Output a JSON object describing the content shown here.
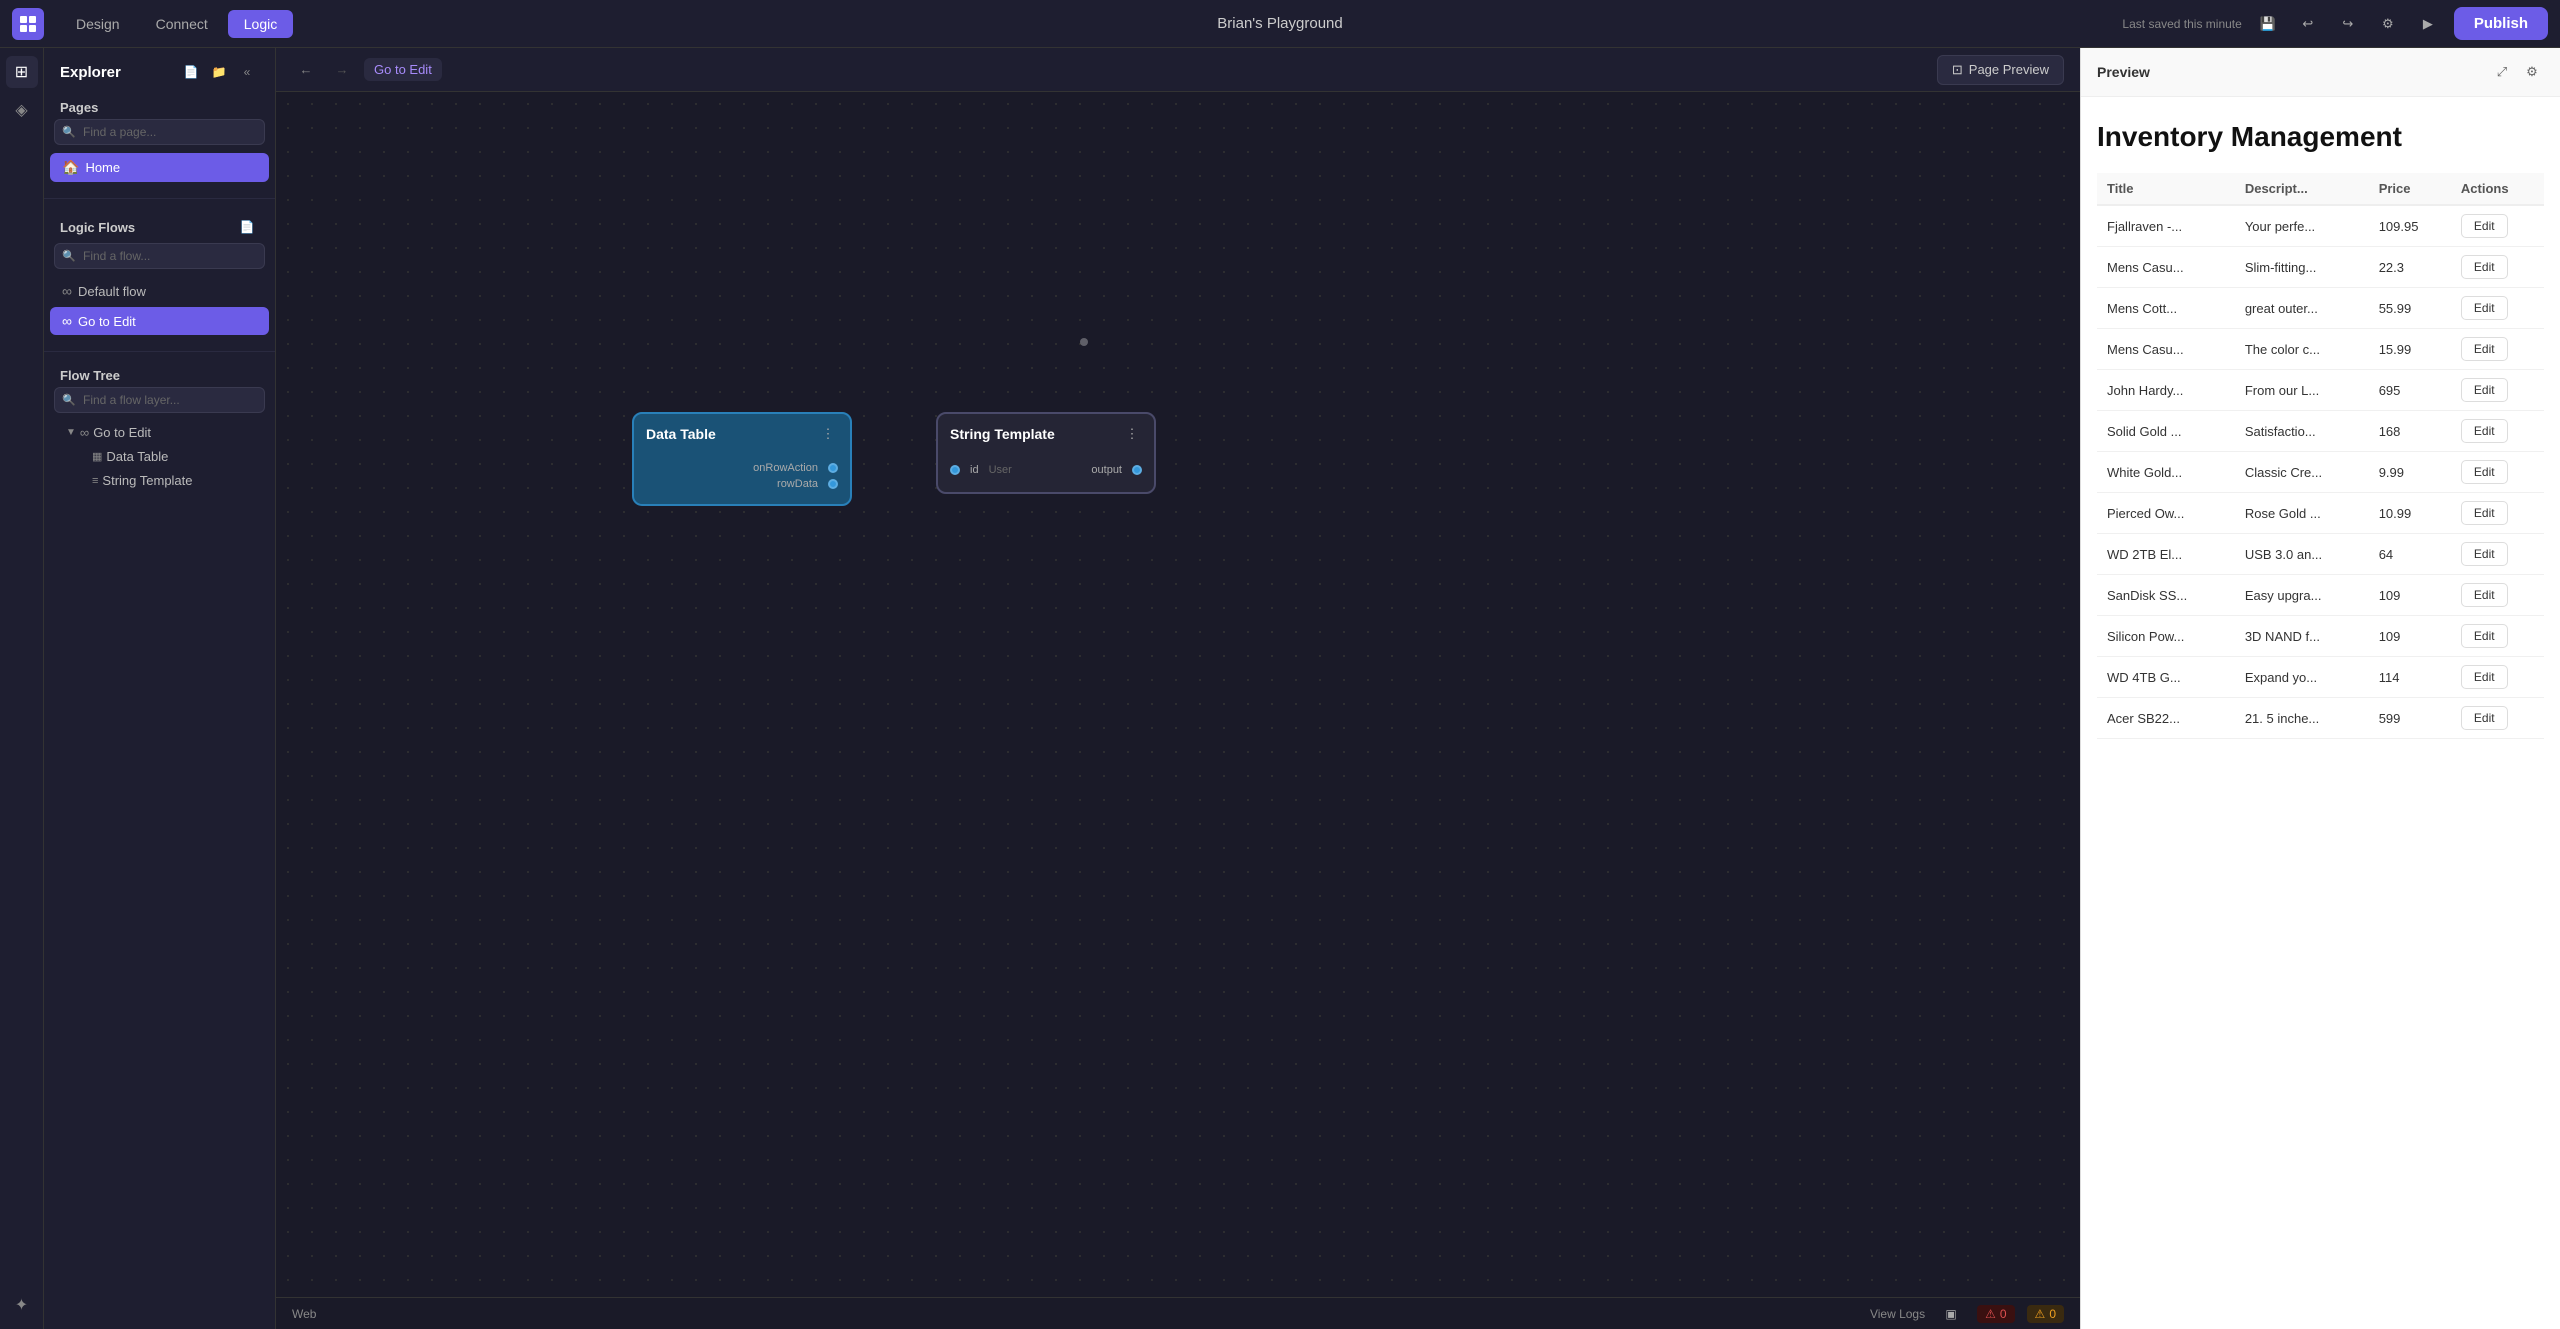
{
  "topbar": {
    "title": "Brian's Playground",
    "tabs": [
      "Design",
      "Connect",
      "Logic"
    ],
    "active_tab": "Logic",
    "save_info": "Last saved  this minute",
    "publish_label": "Publish"
  },
  "sidebar": {
    "title": "Explorer",
    "pages_section": "Pages",
    "pages_search_placeholder": "Find a page...",
    "pages": [
      {
        "label": "Home",
        "icon": "🏠",
        "active": true
      }
    ],
    "logic_flows_section": "Logic Flows",
    "flows_search_placeholder": "Find a flow...",
    "flows": [
      {
        "label": "Default flow",
        "active": false
      },
      {
        "label": "Go to Edit",
        "active": true
      }
    ],
    "flow_tree_section": "Flow Tree",
    "flow_tree_search_placeholder": "Find a flow layer...",
    "flow_tree": {
      "root": "Go to Edit",
      "children": [
        {
          "label": "Data Table",
          "icon": "table"
        },
        {
          "label": "String Template",
          "icon": "string"
        }
      ]
    }
  },
  "canvas": {
    "breadcrumb": "Go to Edit",
    "page_preview_label": "Page Preview",
    "nodes": [
      {
        "id": "data-table",
        "title": "Data Table",
        "type": "data-table",
        "ports_out": [
          "onRowAction",
          "rowData"
        ]
      },
      {
        "id": "string-template",
        "title": "String Template",
        "type": "string-template",
        "ports_in": [
          "id",
          "User"
        ],
        "ports_out": [
          "output"
        ]
      }
    ]
  },
  "preview": {
    "title": "Preview",
    "main_title": "Inventory Management",
    "columns": [
      "Title",
      "Descript...",
      "Price",
      "Actions"
    ],
    "rows": [
      {
        "title": "Fjallraven -...",
        "desc": "Your perfe...",
        "price": "109.95"
      },
      {
        "title": "Mens Casu...",
        "desc": "Slim-fitting...",
        "price": "22.3"
      },
      {
        "title": "Mens Cott...",
        "desc": "great outer...",
        "price": "55.99"
      },
      {
        "title": "Mens Casu...",
        "desc": "The color c...",
        "price": "15.99"
      },
      {
        "title": "John Hardy...",
        "desc": "From our L...",
        "price": "695"
      },
      {
        "title": "Solid Gold ...",
        "desc": "Satisfactio...",
        "price": "168"
      },
      {
        "title": "White Gold...",
        "desc": "Classic Cre...",
        "price": "9.99"
      },
      {
        "title": "Pierced Ow...",
        "desc": "Rose Gold ...",
        "price": "10.99"
      },
      {
        "title": "WD 2TB El...",
        "desc": "USB 3.0 an...",
        "price": "64"
      },
      {
        "title": "SanDisk SS...",
        "desc": "Easy upgra...",
        "price": "109"
      },
      {
        "title": "Silicon Pow...",
        "desc": "3D NAND f...",
        "price": "109"
      },
      {
        "title": "WD 4TB G...",
        "desc": "Expand yo...",
        "price": "114"
      },
      {
        "title": "Acer SB22...",
        "desc": "21. 5 inche...",
        "price": "599"
      }
    ],
    "row_action_label": "Edit"
  },
  "statusbar": {
    "platform": "Web",
    "view_logs": "View Logs",
    "error_count": "0",
    "warn_count": "0"
  }
}
